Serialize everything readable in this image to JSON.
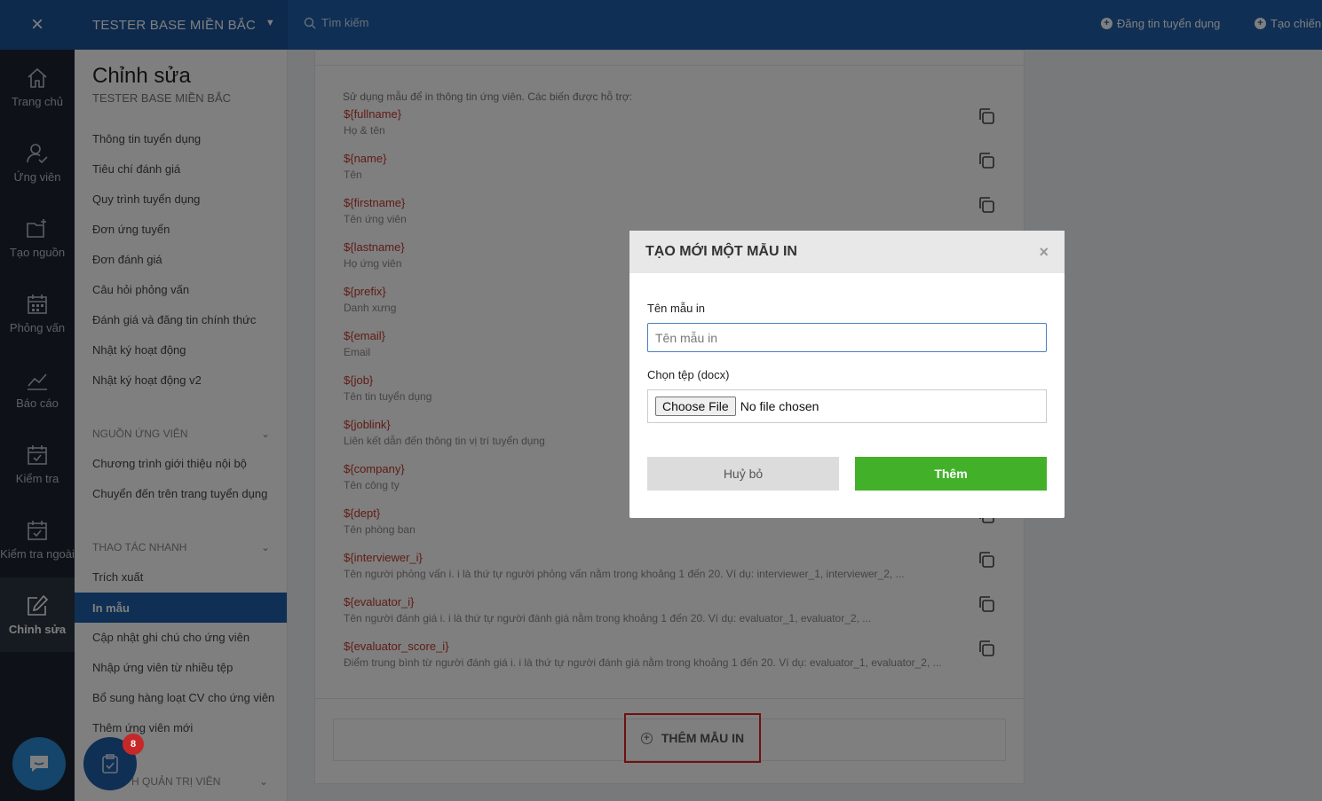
{
  "topbar": {
    "org_name": "TESTER BASE MIỀN BẮC",
    "search_placeholder": "Tìm kiếm",
    "post_job": "Đăng tin tuyển dụng",
    "create_campaign": "Tạo chiến"
  },
  "rail": [
    {
      "label": "Trang chủ",
      "icon": "home-icon"
    },
    {
      "label": "Ứng viên",
      "icon": "user-check-icon"
    },
    {
      "label": "Tạo nguồn",
      "icon": "folder-plus-icon"
    },
    {
      "label": "Phỏng vấn",
      "icon": "calendar-grid-icon"
    },
    {
      "label": "Báo cáo",
      "icon": "chart-line-icon"
    },
    {
      "label": "Kiểm tra",
      "icon": "calendar-check-icon"
    },
    {
      "label": "Kiểm tra ngoài",
      "icon": "calendar-check-icon"
    },
    {
      "label": "Chỉnh sửa",
      "icon": "edit-icon"
    }
  ],
  "sidebar": {
    "title": "Chỉnh sửa",
    "subtitle": "TESTER BASE MIỀN BẮC",
    "items": [
      "Thông tin tuyển dụng",
      "Tiêu chí đánh giá",
      "Quy trình tuyển dụng",
      "Đơn ứng tuyển",
      "Đơn đánh giá",
      "Câu hỏi phỏng vấn",
      "Đánh giá và đăng tin chính thức",
      "Nhật ký hoạt động",
      "Nhật ký hoạt động v2"
    ],
    "section_sources": "NGUỒN ỨNG VIÊN",
    "source_items": [
      "Chương trình giới thiệu nội bộ",
      "Chuyển đến trên trang tuyển dụng"
    ],
    "section_quick": "THAO TÁC NHANH",
    "quick_items": [
      "Trích xuất",
      "In mẫu",
      "Cập nhật ghi chú cho ứng viên",
      "Nhập ứng viên từ nhiều tệp",
      "Bổ sung hàng loạt CV cho ứng viên",
      "Thêm ứng viên mới"
    ],
    "section_admin": "H QUẢN TRỊ VIÊN"
  },
  "panel": {
    "intro": "Sử dụng mẫu để in thông tin ứng viên. Các biến được hỗ trợ:",
    "variables": [
      {
        "code": "${fullname}",
        "desc": "Họ & tên"
      },
      {
        "code": "${name}",
        "desc": "Tên"
      },
      {
        "code": "${firstname}",
        "desc": "Tên ứng viên"
      },
      {
        "code": "${lastname}",
        "desc": "Họ ứng viên"
      },
      {
        "code": "${prefix}",
        "desc": "Danh xưng"
      },
      {
        "code": "${email}",
        "desc": "Email"
      },
      {
        "code": "${job}",
        "desc": "Tên tin tuyển dụng"
      },
      {
        "code": "${joblink}",
        "desc": "Liên kết dẫn đến thông tin vị trí tuyển dụng"
      },
      {
        "code": "${company}",
        "desc": "Tên công ty"
      },
      {
        "code": "${dept}",
        "desc": "Tên phòng ban"
      },
      {
        "code": "${interviewer_i}",
        "desc": "Tên người phỏng vấn i. i là thứ tự người phỏng vấn nằm trong khoảng 1 đến 20. Ví dụ: interviewer_1, interviewer_2, ..."
      },
      {
        "code": "${evaluator_i}",
        "desc": "Tên người đánh giá i. i là thứ tự người đánh giá nằm trong khoảng 1 đến 20. Ví dụ: evaluator_1, evaluator_2, ..."
      },
      {
        "code": "${evaluator_score_i}",
        "desc": "Điểm trung bình từ người đánh giá i. i là thứ tự người đánh giá nằm trong khoảng 1 đến 20. Ví dụ: evaluator_1, evaluator_2, ..."
      }
    ],
    "add_template": "THÊM MẪU IN"
  },
  "modal": {
    "title": "TẠO MỚI MỘT MẪU IN",
    "name_label": "Tên mẫu in",
    "name_placeholder": "Tên mẫu in",
    "file_label": "Chọn tệp (docx)",
    "file_button": "Choose File",
    "file_status": "No file chosen",
    "cancel": "Huỷ bỏ",
    "submit": "Thêm",
    "close": "×"
  },
  "badge_count": "8",
  "colors": {
    "brand": "#1f5faa",
    "accent_green": "#43b02a",
    "variable_red": "#c0392b",
    "highlight_red": "#e02020"
  }
}
